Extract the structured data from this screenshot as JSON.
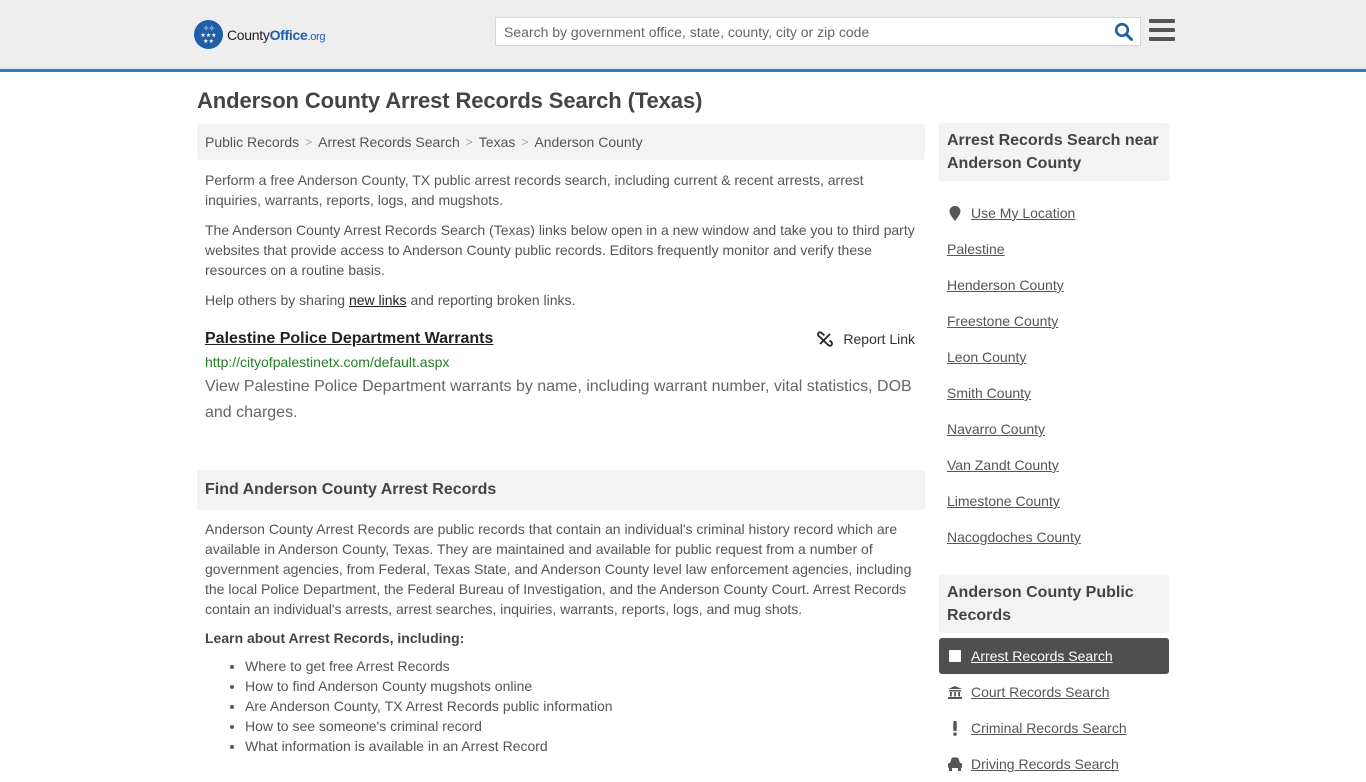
{
  "header": {
    "logo": {
      "name_part1": "County",
      "name_part2": "Office",
      "tld": ".org"
    },
    "search": {
      "placeholder": "Search by government office, state, county, city or zip code",
      "value": ""
    },
    "colors": {
      "brand": "#1f5fa8",
      "header_bg": "#eeeeee",
      "header_border": "#3a7ab0"
    }
  },
  "page": {
    "title": "Anderson County Arrest Records Search (Texas)"
  },
  "breadcrumb": [
    {
      "label": "Public Records"
    },
    {
      "label": "Arrest Records Search"
    },
    {
      "label": "Texas"
    },
    {
      "label": "Anderson County"
    }
  ],
  "intro": {
    "p1": "Perform a free Anderson County, TX public arrest records search, including current & recent arrests, arrest inquiries, warrants, reports, logs, and mugshots.",
    "p2": "The Anderson County Arrest Records Search (Texas) links below open in a new window and take you to third party websites that provide access to Anderson County public records. Editors frequently monitor and verify these resources on a routine basis.",
    "p3_before": "Help others by sharing ",
    "p3_link": "new links",
    "p3_after": " and reporting broken links."
  },
  "results": [
    {
      "title": "Palestine Police Department Warrants",
      "url": "http://cityofpalestinetx.com/default.aspx",
      "description": "View Palestine Police Department warrants by name, including warrant number, vital statistics, DOB and charges.",
      "report_label": "Report Link"
    }
  ],
  "find_section": {
    "heading": "Find Anderson County Arrest Records",
    "body": "Anderson County Arrest Records are public records that contain an individual's criminal history record which are available in Anderson County, Texas. They are maintained and available for public request from a number of government agencies, from Federal, Texas State, and Anderson County level law enforcement agencies, including the local Police Department, the Federal Bureau of Investigation, and the Anderson County Court. Arrest Records contain an individual's arrests, arrest searches, inquiries, warrants, reports, logs, and mug shots.",
    "learn_heading": "Learn about Arrest Records, including:",
    "learn_items": [
      "Where to get free Arrest Records",
      "How to find Anderson County mugshots online",
      "Are Anderson County, TX Arrest Records public information",
      "How to see someone's criminal record",
      "What information is available in an Arrest Record"
    ]
  },
  "sidebar": {
    "nearby": {
      "heading": "Arrest Records Search near Anderson County",
      "use_location": "Use My Location",
      "items": [
        "Palestine",
        "Henderson County",
        "Freestone County",
        "Leon County",
        "Smith County",
        "Navarro County",
        "Van Zandt County",
        "Limestone County",
        "Nacogdoches County"
      ]
    },
    "public_records": {
      "heading": "Anderson County Public Records",
      "items": [
        {
          "label": "Arrest Records Search",
          "icon": "square-icon",
          "active": true
        },
        {
          "label": "Court Records Search",
          "icon": "courthouse-icon",
          "active": false
        },
        {
          "label": "Criminal Records Search",
          "icon": "exclamation-icon",
          "active": false
        },
        {
          "label": "Driving Records Search",
          "icon": "car-icon",
          "active": false
        }
      ]
    }
  }
}
